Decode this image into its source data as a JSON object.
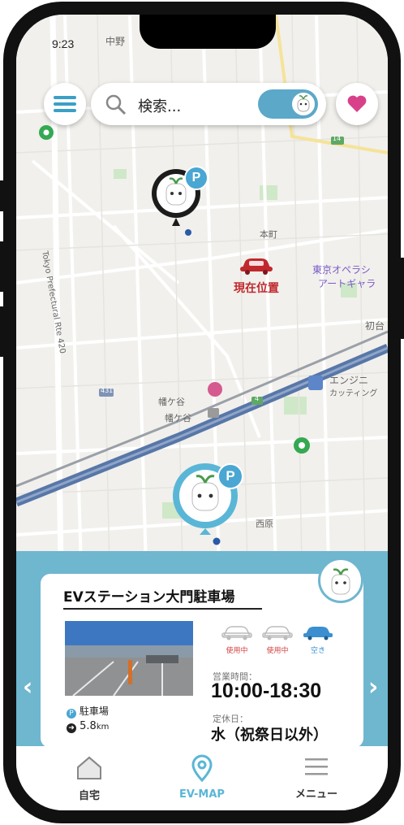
{
  "status": {
    "time": "9:23"
  },
  "topbar": {
    "search_placeholder": "検索...",
    "menu_icon": "hamburger-icon",
    "favorite_icon": "heart-icon",
    "colors": {
      "menu": "#3aa0c8",
      "heart": "#d8418a",
      "toggle": "#5ba8c9"
    }
  },
  "map": {
    "labels": {
      "tokyo_route": "Tokyo Prefectural Rte 420",
      "honmachi": "本町",
      "opera": "東京オペラシ",
      "art": "アートギャラ",
      "hatsudai": "初台",
      "hatagaya": "幡ケ谷",
      "hatagaya2": "幡ケ谷",
      "engine": "エンジニ",
      "cutting": "カッティング",
      "nishihara": "西原",
      "nakano": "中野",
      "route431": "431",
      "route4": "4",
      "route14": "14"
    },
    "current_location_label": "現在位置",
    "parking_badge": "P"
  },
  "card": {
    "title": "EVステーション大門駐車場",
    "type_label": "駐車場",
    "distance_value": "5.8",
    "distance_unit": "km",
    "cars": [
      {
        "label": "使用中",
        "status": "in-use"
      },
      {
        "label": "使用中",
        "status": "in-use"
      },
      {
        "label": "空き",
        "status": "available"
      }
    ],
    "hours_label": "営業時間：",
    "hours_value": "10:00-18:30",
    "closed_label": "定休日：",
    "closed_value": "水（祝祭日以外）"
  },
  "tabs": [
    {
      "label": "自宅",
      "icon": "home-icon",
      "active": false
    },
    {
      "label": "EV-MAP",
      "icon": "map-pin-icon",
      "active": true
    },
    {
      "label": "メニュー",
      "icon": "menu-lines-icon",
      "active": false
    }
  ],
  "colors": {
    "accent": "#5ab6d6",
    "panel": "#6fb6cf",
    "alert_red": "#c0282d"
  }
}
